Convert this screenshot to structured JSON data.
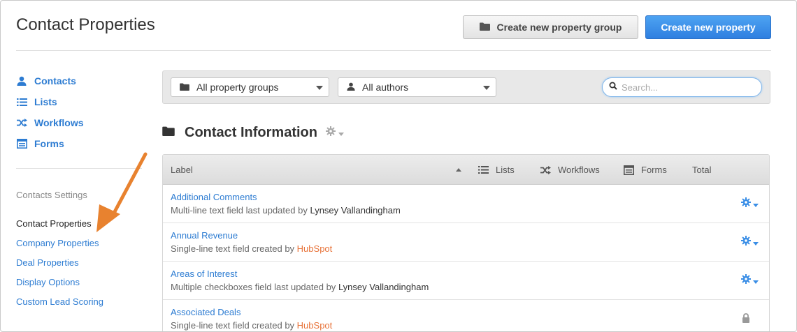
{
  "header": {
    "title": "Contact Properties",
    "create_group_label": "Create new property group",
    "create_property_label": "Create new property"
  },
  "sidebar": {
    "nav": [
      {
        "label": "Contacts",
        "icon": "person-icon"
      },
      {
        "label": "Lists",
        "icon": "list-icon"
      },
      {
        "label": "Workflows",
        "icon": "shuffle-icon"
      },
      {
        "label": "Forms",
        "icon": "form-icon"
      }
    ],
    "settings_heading": "Contacts Settings",
    "settings": [
      {
        "label": "Contact Properties",
        "active": true
      },
      {
        "label": "Company Properties"
      },
      {
        "label": "Deal Properties"
      },
      {
        "label": "Display Options"
      },
      {
        "label": "Custom Lead Scoring"
      }
    ]
  },
  "filters": {
    "group_select": "All property groups",
    "author_select": "All authors",
    "search_placeholder": "Search..."
  },
  "section": {
    "title": "Contact Information"
  },
  "table": {
    "columns": {
      "label": "Label",
      "lists": "Lists",
      "workflows": "Workflows",
      "forms": "Forms",
      "total": "Total"
    },
    "rows": [
      {
        "name": "Additional Comments",
        "desc_prefix": "Multi-line text field last updated by",
        "author": "Lynsey Vallandingham",
        "action": "gear"
      },
      {
        "name": "Annual Revenue",
        "desc_prefix": "Single-line text field created by",
        "author": "HubSpot",
        "action": "gear"
      },
      {
        "name": "Areas of Interest",
        "desc_prefix": "Multiple checkboxes field last updated by",
        "author": "Lynsey Vallandingham",
        "action": "gear"
      },
      {
        "name": "Associated Deals",
        "desc_prefix": "Single-line text field created by",
        "author": "HubSpot",
        "action": "lock"
      }
    ]
  },
  "colors": {
    "link": "#2d7cd2",
    "primary_button": "#3a8ee6",
    "hubspot_orange": "#e8743b",
    "annotation_arrow": "#e8822f"
  }
}
